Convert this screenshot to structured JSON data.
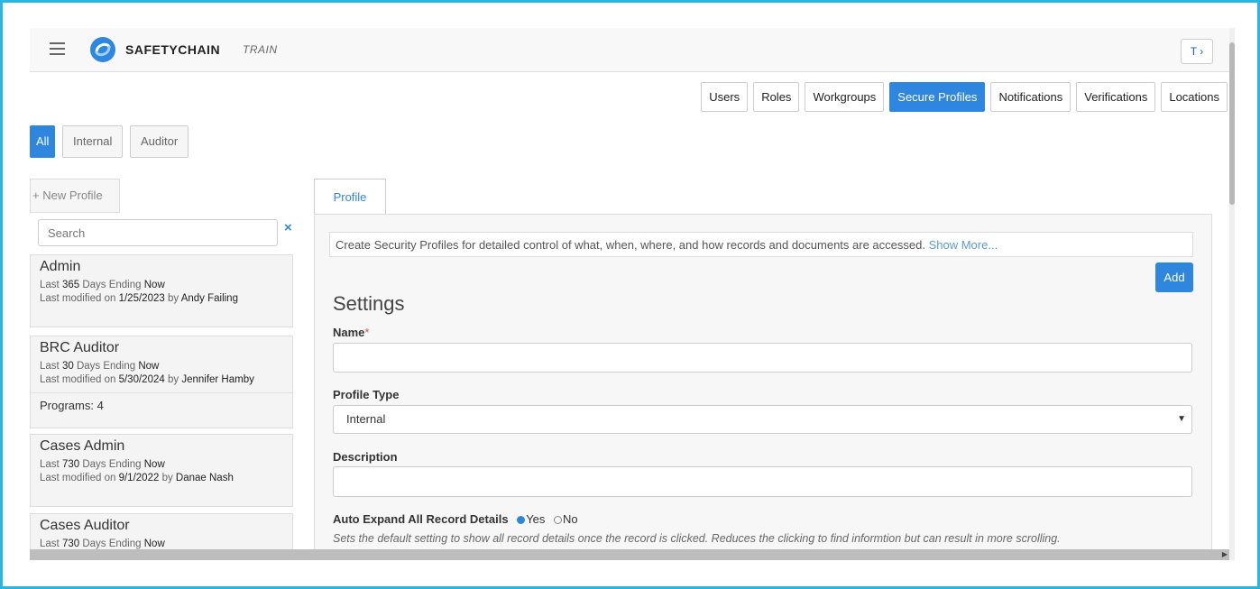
{
  "header": {
    "brand": "SAFETYCHAIN",
    "environment": "TRAIN",
    "filter_label": "T ›"
  },
  "nav_tabs": [
    {
      "label": "Users",
      "active": false
    },
    {
      "label": "Roles",
      "active": false
    },
    {
      "label": "Workgroups",
      "active": false
    },
    {
      "label": "Secure Profiles",
      "active": true
    },
    {
      "label": "Notifications",
      "active": false
    },
    {
      "label": "Verifications",
      "active": false
    },
    {
      "label": "Locations",
      "active": false
    }
  ],
  "filters": {
    "all": "All",
    "internal": "Internal",
    "auditor": "Auditor"
  },
  "sidebar": {
    "new_profile": "+ New Profile",
    "search_placeholder": "Search",
    "clear": "×",
    "profiles": [
      {
        "name": "Admin",
        "days": "365",
        "days_suffix": "Days Ending",
        "ending": "Now",
        "modified_prefix": "Last modified on",
        "date": "1/25/2023",
        "by": "by",
        "user": "Andy Failing",
        "programs": ""
      },
      {
        "name": "BRC Auditor",
        "days": "30",
        "days_suffix": "Days Ending",
        "ending": "Now",
        "modified_prefix": "Last modified on",
        "date": "5/30/2024",
        "by": "by",
        "user": "Jennifer Hamby",
        "programs": "Programs: 4"
      },
      {
        "name": "Cases Admin",
        "days": "730",
        "days_suffix": "Days Ending",
        "ending": "Now",
        "modified_prefix": "Last modified on",
        "date": "9/1/2022",
        "by": "by",
        "user": "Danae Nash",
        "programs": ""
      },
      {
        "name": "Cases Auditor",
        "days": "730",
        "days_suffix": "Days Ending",
        "ending": "Now",
        "modified_prefix": "",
        "date": "",
        "by": "",
        "user": "",
        "programs": ""
      }
    ]
  },
  "detail": {
    "tab": "Profile",
    "intro": "Create Security Profiles for detailed control of what, when, where, and how records and documents are accessed.",
    "show_more": "Show More...",
    "add": "Add",
    "settings": "Settings",
    "name_label": "Name",
    "required_mark": "*",
    "profile_type_label": "Profile Type",
    "profile_type_value": "Internal",
    "description_label": "Description",
    "auto_expand_label": "Auto Expand All Record Details",
    "yes": "Yes",
    "no": "No",
    "auto_expand_hint": "Sets the default setting to show all record details once the record is clicked. Reduces the clicking to find informtion but can result in more scrolling."
  },
  "colors": {
    "accent": "#2e86de",
    "frame": "#29b6e0"
  }
}
